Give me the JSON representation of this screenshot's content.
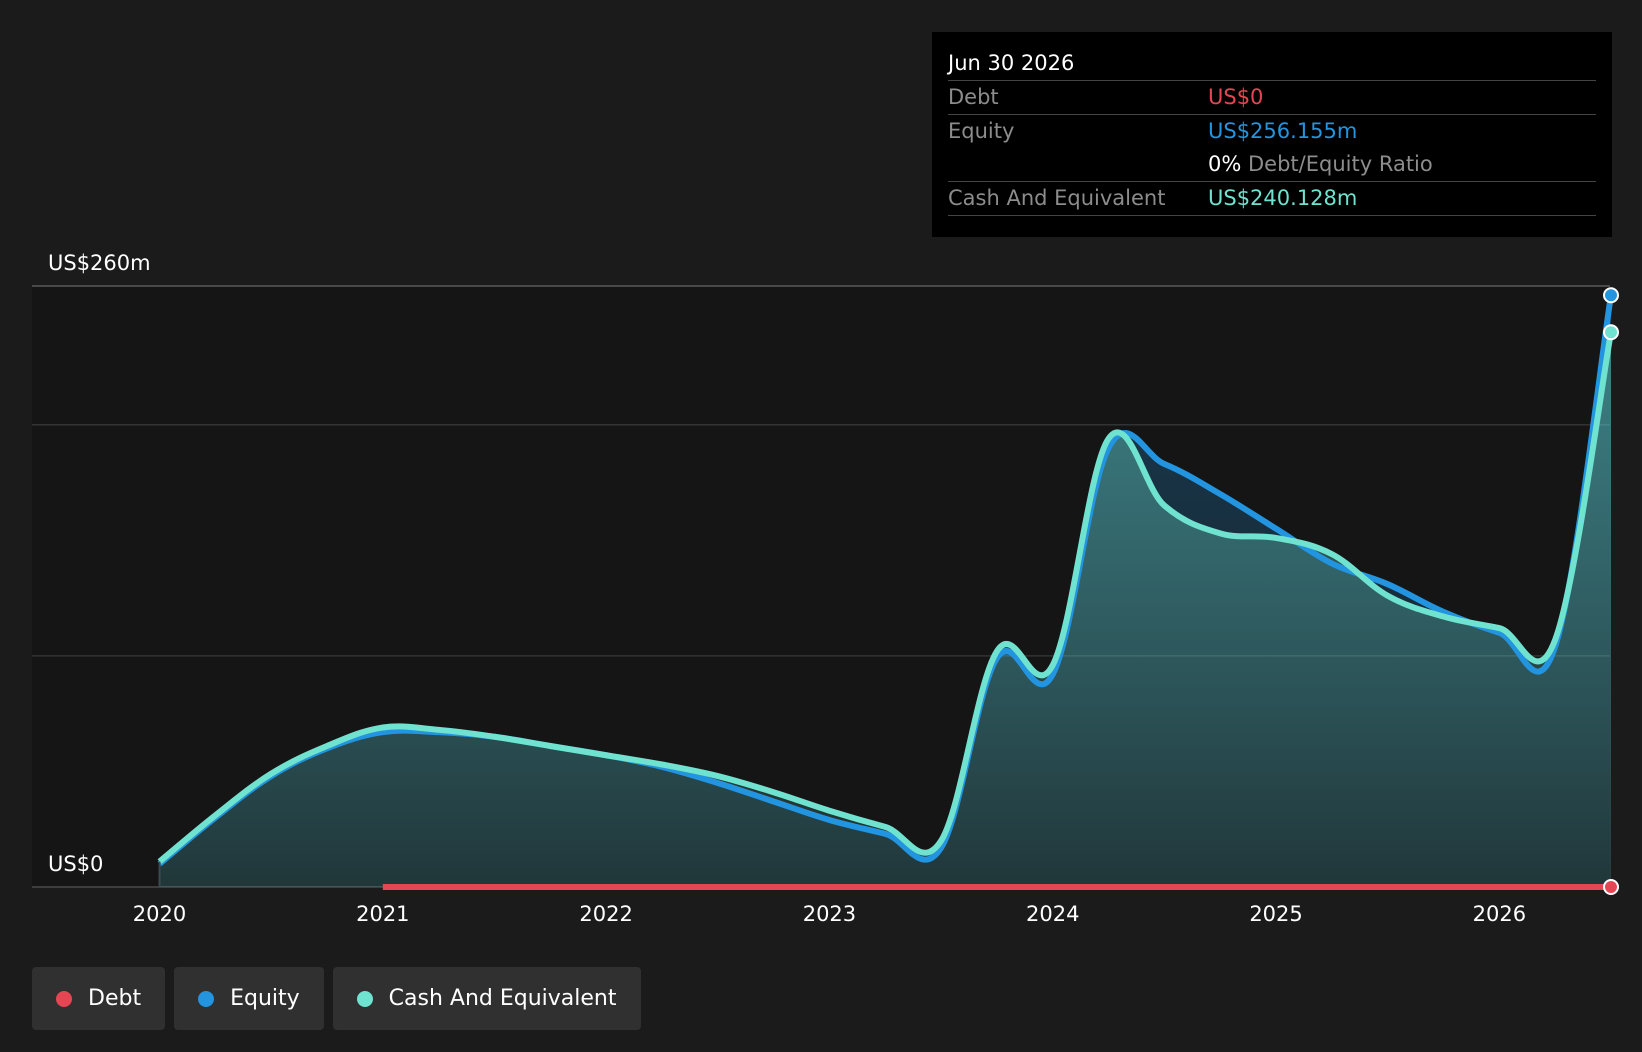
{
  "colors": {
    "background": "#1b1b1b",
    "plot_background": "#151515",
    "debt": "#e64553",
    "equity": "#2394df",
    "cash": "#6fe3cf",
    "text": "#ffffff",
    "muted": "#8c8c8c"
  },
  "tooltip": {
    "date": "Jun 30 2026",
    "debt_label": "Debt",
    "debt_value": "US$0",
    "equity_label": "Equity",
    "equity_value": "US$256.155m",
    "ratio_value": "0%",
    "ratio_label": "Debt/Equity Ratio",
    "cash_label": "Cash And Equivalent",
    "cash_value": "US$240.128m"
  },
  "legend": {
    "debt": "Debt",
    "equity": "Equity",
    "cash": "Cash And Equivalent"
  },
  "chart_data": {
    "type": "area",
    "y_top_label": "US$260m",
    "y_bottom_label": "US$0",
    "ylim": [
      0,
      260
    ],
    "xlim": [
      2019.72,
      2026.5
    ],
    "y_gridlines": [
      260,
      200,
      100
    ],
    "x_ticks": [
      2020,
      2021,
      2022,
      2023,
      2024,
      2025,
      2026
    ],
    "x_tick_labels": [
      "2020",
      "2021",
      "2022",
      "2023",
      "2024",
      "2025",
      "2026"
    ],
    "highlight_x": 2026.5,
    "legend_position": "bottom-left",
    "series": [
      {
        "name": "Debt",
        "key": "debt",
        "x": [
          2021.0,
          2026.5
        ],
        "values": [
          0,
          0
        ]
      },
      {
        "name": "Equity",
        "key": "equity",
        "x": [
          2020.0,
          2020.25,
          2020.5,
          2020.75,
          2021.0,
          2021.25,
          2021.5,
          2021.75,
          2022.0,
          2022.25,
          2022.5,
          2022.75,
          2023.0,
          2023.25,
          2023.5,
          2023.75,
          2024.0,
          2024.25,
          2024.5,
          2024.75,
          2025.0,
          2025.25,
          2025.5,
          2025.75,
          2026.0,
          2026.25,
          2026.5
        ],
        "values": [
          10,
          30,
          48,
          60,
          67,
          67,
          65,
          61,
          57,
          52,
          45,
          37,
          29,
          23,
          17,
          99,
          92,
          190,
          183,
          170,
          155,
          140,
          131,
          119,
          110,
          104,
          256
        ]
      },
      {
        "name": "Cash And Equivalent",
        "key": "cash",
        "x": [
          2020.0,
          2020.25,
          2020.5,
          2020.75,
          2021.0,
          2021.25,
          2021.5,
          2021.75,
          2022.0,
          2022.25,
          2022.5,
          2022.75,
          2023.0,
          2023.25,
          2023.5,
          2023.75,
          2024.0,
          2024.25,
          2024.5,
          2024.75,
          2025.0,
          2025.25,
          2025.5,
          2025.75,
          2026.0,
          2026.25,
          2026.5
        ],
        "values": [
          11,
          31,
          49,
          61,
          69,
          68,
          65,
          61,
          57,
          53,
          48,
          41,
          33,
          26,
          20,
          102,
          96,
          194,
          165,
          153,
          151,
          144,
          126,
          117,
          112,
          107,
          240
        ]
      }
    ]
  }
}
